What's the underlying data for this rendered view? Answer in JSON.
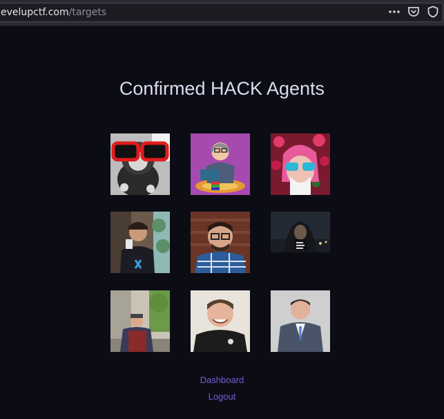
{
  "browser": {
    "url_host": "evelupctf.com",
    "url_path": "/targets",
    "icons": [
      "more-icon",
      "pocket-icon",
      "shield-icon"
    ]
  },
  "page": {
    "title": "Confirmed HACK Agents"
  },
  "agents": [
    {
      "name": "agent-1-avatar",
      "description": "plush toy with red sunglasses"
    },
    {
      "name": "agent-2-avatar",
      "description": "cartoon person on laptop"
    },
    {
      "name": "agent-3-avatar",
      "description": "pink hair with flowers and sunglasses"
    },
    {
      "name": "agent-4-avatar",
      "description": "man in street with plants"
    },
    {
      "name": "agent-5-avatar",
      "description": "man with glasses and plaid shirt"
    },
    {
      "name": "agent-6-avatar",
      "description": "hooded figure eat sleep hack shirt"
    },
    {
      "name": "agent-7-avatar",
      "description": "older man in street"
    },
    {
      "name": "agent-8-avatar",
      "description": "smiling man dark hoodie"
    },
    {
      "name": "agent-9-avatar",
      "description": "man in suit"
    }
  ],
  "nav": {
    "dashboard_label": "Dashboard",
    "logout_label": "Logout"
  },
  "colors": {
    "background": "#0c0c15",
    "title": "#dcdcf0",
    "link": "#7b5cd6"
  }
}
